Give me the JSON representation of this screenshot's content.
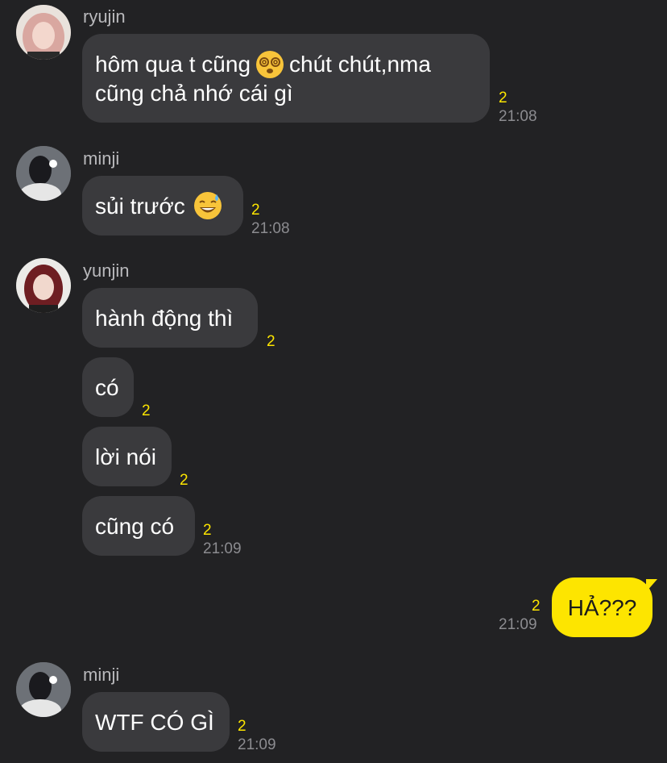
{
  "messages": [
    {
      "sender": "ryujin",
      "lines": [
        "hôm qua t cũng",
        "chút chút,nma",
        "cũng chả nhớ cái gì"
      ],
      "emoji": "dizzy-face-icon",
      "unread": "2",
      "time": "21:08"
    },
    {
      "sender": "minji",
      "text": "sủi trước",
      "emoji": "sweat-smile-icon",
      "unread": "2",
      "time": "21:08"
    },
    {
      "sender": "yunjin",
      "group": [
        {
          "text": "hành động thì",
          "unread": "2"
        },
        {
          "text": "có",
          "unread": "2"
        },
        {
          "text": "lời nói",
          "unread": "2"
        },
        {
          "text": "cũng có",
          "unread": "2",
          "time": "21:09"
        }
      ]
    },
    {
      "sender": "me",
      "text": "HẢ???",
      "unread": "2",
      "time": "21:09"
    },
    {
      "sender": "minji",
      "text": "WTF CÓ GÌ",
      "unread": "2",
      "time": "21:09"
    }
  ],
  "colors": {
    "background": "#222224",
    "bubble": "#3a3a3d",
    "my_bubble": "#fde500",
    "unread": "#fde500",
    "timestamp": "#8c8c90"
  }
}
